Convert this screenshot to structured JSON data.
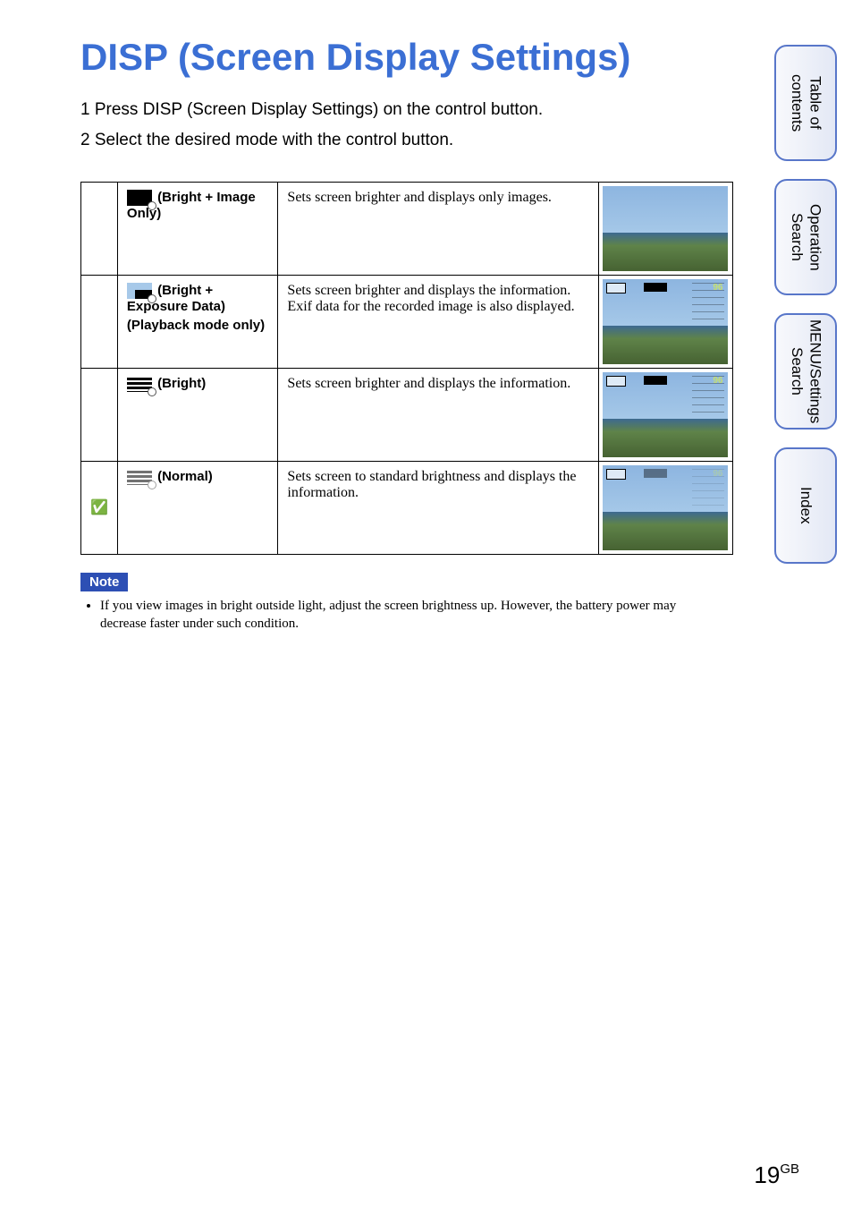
{
  "title": "DISP (Screen Display Settings)",
  "steps": {
    "s1": "1 Press DISP (Screen Display Settings) on the control button.",
    "s2": "2 Select the desired mode with the control button."
  },
  "rows": {
    "r1": {
      "label": "(Bright + Image Only)",
      "desc": "Sets screen brighter and displays only images."
    },
    "r2": {
      "label_top": "(Bright + Exposure Data)",
      "label_sub": "(Playback mode only)",
      "desc": "Sets screen brighter and displays the information.\nExif data for the recorded image is also displayed."
    },
    "r3": {
      "label": "(Bright)",
      "desc": "Sets screen brighter and displays the information."
    },
    "r4": {
      "label": "(Normal)",
      "desc": "Sets screen to standard brightness and displays the information."
    }
  },
  "note": {
    "header": "Note",
    "body": "If you view images in bright outside light, adjust the screen brightness up. However, the battery power may decrease faster under such condition."
  },
  "overlay_num": "96",
  "tabs": {
    "t1": "Table of contents",
    "t2": "Operation Search",
    "t3": "MENU/Settings Search",
    "t4": "Index"
  },
  "page": {
    "num": "19",
    "suffix": "GB"
  }
}
